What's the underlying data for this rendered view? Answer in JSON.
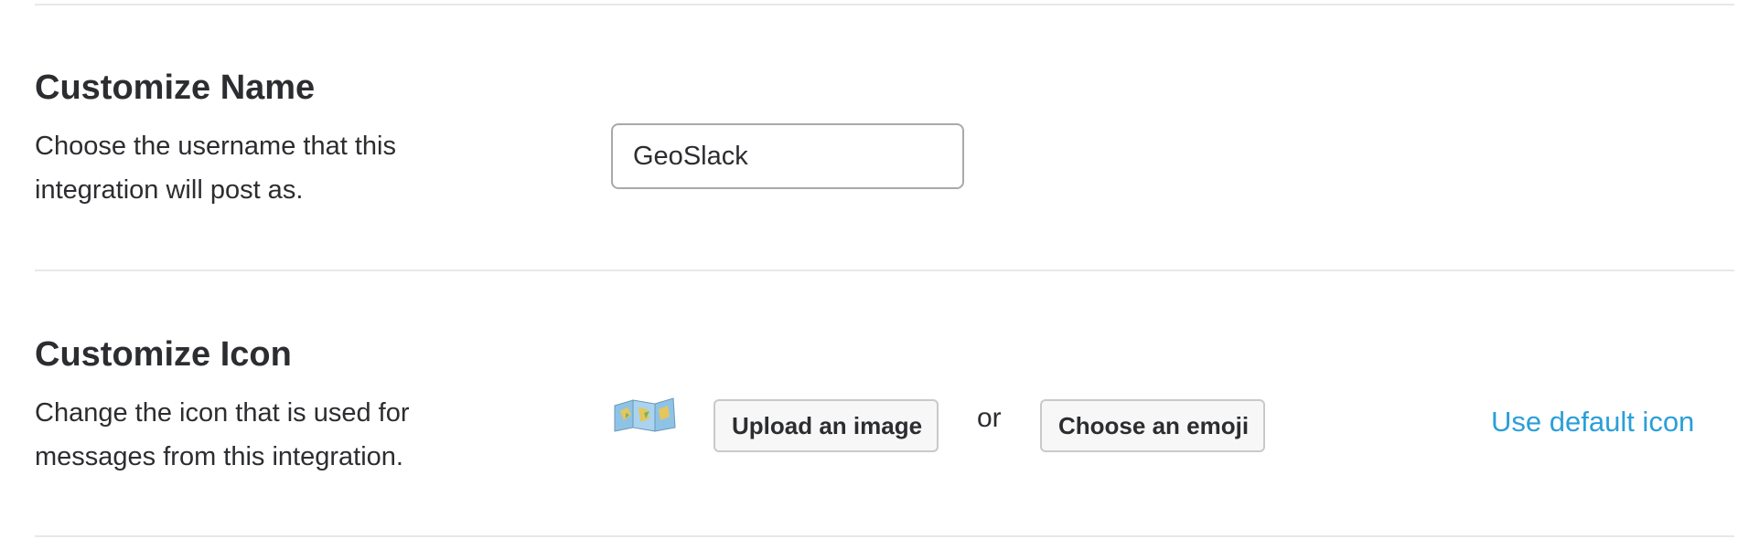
{
  "customize_name": {
    "title": "Customize Name",
    "description": "Choose the username that this integration will post as.",
    "username_value": "GeoSlack"
  },
  "customize_icon": {
    "title": "Customize Icon",
    "description": "Change the icon that is used for messages from this integration.",
    "icon": "world-map-icon",
    "upload_button": "Upload an image",
    "or_text": "or",
    "emoji_button": "Choose an emoji",
    "default_link": "Use default icon"
  },
  "colors": {
    "link": "#2a9fd8",
    "text": "#2c2d30",
    "divider": "#e8e8e8"
  }
}
